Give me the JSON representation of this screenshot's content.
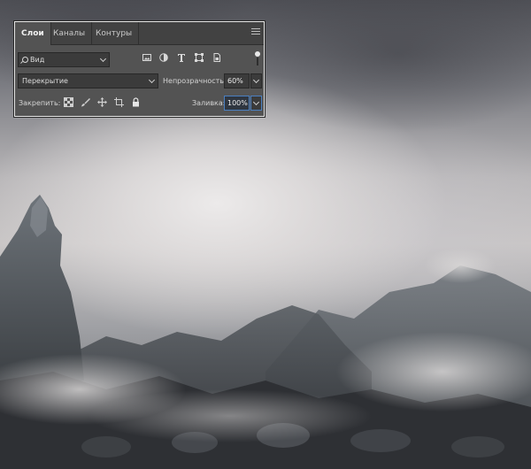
{
  "panel": {
    "tabs": [
      {
        "label": "Слои",
        "active": true
      },
      {
        "label": "Каналы",
        "active": false
      },
      {
        "label": "Контуры",
        "active": false
      }
    ],
    "menu_icon": "hamburger-menu-icon",
    "filter": {
      "kind_value": "Вид",
      "icons": [
        "image-filter-icon",
        "adjustment-filter-icon",
        "type-filter-icon",
        "shape-filter-icon",
        "smart-object-filter-icon"
      ],
      "toggle_icon": "filter-toggle-icon"
    },
    "blend": {
      "mode_value": "Перекрытие",
      "opacity_label": "Непрозрачность:",
      "opacity_value": "60%"
    },
    "lock": {
      "label": "Закрепить:",
      "icons": [
        "lock-transparent-pixels-icon",
        "lock-image-pixels-icon",
        "lock-position-icon",
        "lock-artboard-icon",
        "lock-all-icon"
      ],
      "fill_label": "Заливка:",
      "fill_value": "100%"
    }
  },
  "colors": {
    "panel_bg": "#535353",
    "tabbar_bg": "#424242",
    "field_bg": "#3b3b3b",
    "focus_accent": "#4a7fc0"
  }
}
